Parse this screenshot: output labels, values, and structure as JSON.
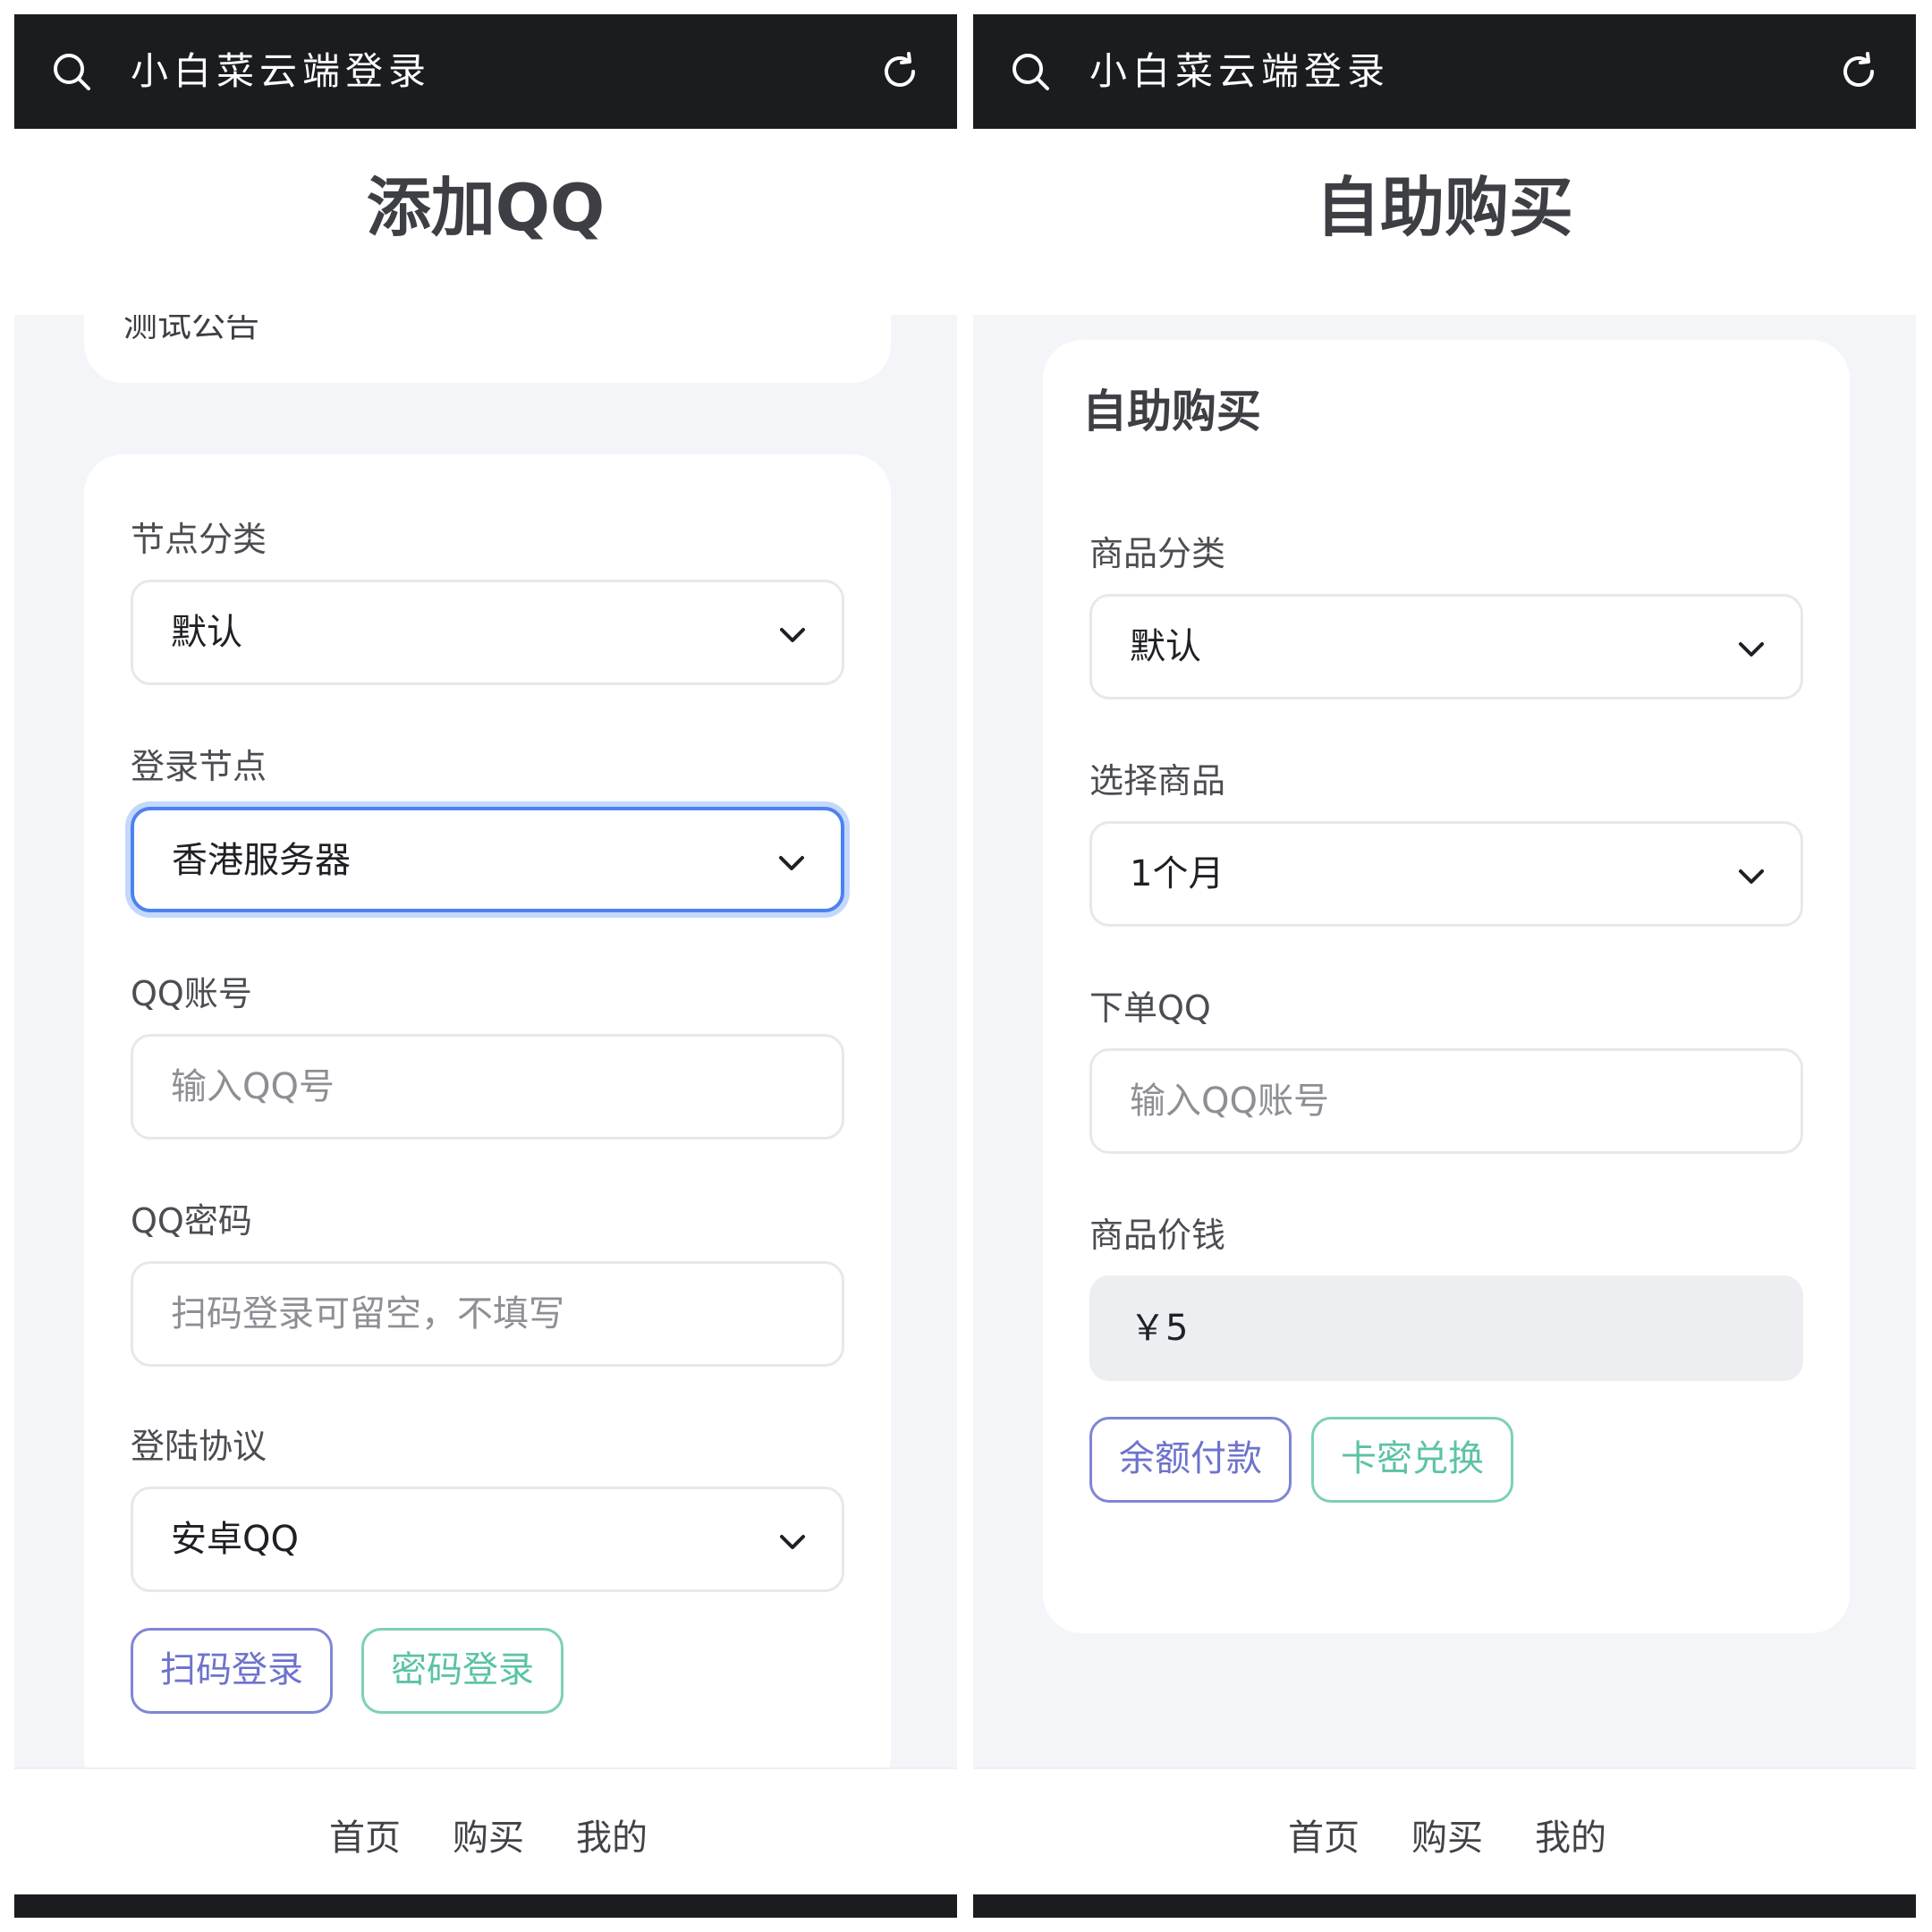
{
  "left_screen": {
    "topbar": {
      "title": "小白菜云端登录"
    },
    "header": {
      "title": "添加QQ"
    },
    "notice_card": {
      "text": "测试公告"
    },
    "form": {
      "node_category": {
        "label": "节点分类",
        "value": "默认"
      },
      "login_node": {
        "label": "登录节点",
        "value": "香港服务器"
      },
      "qq_account": {
        "label": "QQ账号",
        "placeholder": "输入QQ号"
      },
      "qq_password": {
        "label": "QQ密码",
        "placeholder": "扫码登录可留空，不填写"
      },
      "login_protocol": {
        "label": "登陆协议",
        "value": "安卓QQ"
      },
      "scan_login_button": "扫码登录",
      "password_login_button": "密码登录"
    },
    "bottom_nav": {
      "home": "首页",
      "buy": "购买",
      "mine": "我的"
    }
  },
  "right_screen": {
    "topbar": {
      "title": "小白菜云端登录"
    },
    "header": {
      "title": "自助购买"
    },
    "card": {
      "title": "自助购买",
      "product_category": {
        "label": "商品分类",
        "value": "默认"
      },
      "select_product": {
        "label": "选择商品",
        "value": "1个月"
      },
      "order_qq": {
        "label": "下单QQ",
        "placeholder": "输入QQ账号"
      },
      "product_price": {
        "label": "商品价钱",
        "value": "￥5"
      },
      "balance_pay_button": "余额付款",
      "card_redeem_button": "卡密兑换"
    },
    "bottom_nav": {
      "home": "首页",
      "buy": "购买",
      "mine": "我的"
    }
  },
  "colors": {
    "topbar_bg": "#1b1c20",
    "page_bg": "#f4f5f8",
    "focus_border": "#4c82f0",
    "purple_button": "#6d73cc",
    "teal_button": "#5cc2a6"
  },
  "icons": [
    "search-icon",
    "refresh-icon",
    "chevron-down-icon"
  ]
}
